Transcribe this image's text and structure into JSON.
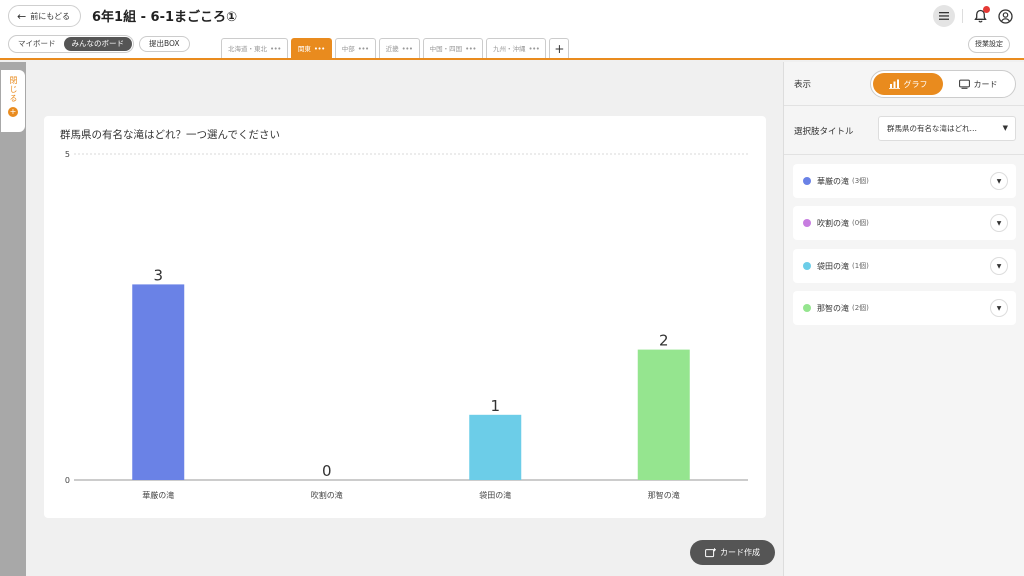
{
  "header": {
    "back_label": "前にもどる",
    "title": "6年1組 - 6-1まごころ①",
    "board_switch": [
      "マイボード",
      "みんなのボード"
    ],
    "submit_box": "提出BOX",
    "lesson_settings": "授業設定",
    "tabs": [
      {
        "label": "北海道・東北",
        "active": false
      },
      {
        "label": "関東",
        "active": true
      },
      {
        "label": "中部",
        "active": false
      },
      {
        "label": "近畿",
        "active": false
      },
      {
        "label": "中国・四国",
        "active": false
      },
      {
        "label": "九州・沖縄",
        "active": false
      }
    ],
    "tab_more": "•••",
    "add_tab": "+"
  },
  "side": {
    "close_label": "閉じる",
    "close_symbol": "+"
  },
  "chart_data": {
    "type": "bar",
    "title": "群馬県の有名な滝はどれ？一つ選んでください",
    "categories": [
      "華厳の滝",
      "吹割の滝",
      "袋田の滝",
      "那智の滝"
    ],
    "values": [
      3,
      0,
      1,
      2
    ],
    "value_labels": [
      "3",
      "0",
      "1",
      "2"
    ],
    "colors": [
      "#6a82e6",
      "#c77de0",
      "#6ccde8",
      "#95e58f"
    ],
    "ylim": [
      0,
      5
    ],
    "yticks": [
      "0",
      "5"
    ],
    "grid": "dashed-top",
    "legend": "none"
  },
  "create_card": "カード作成",
  "panel": {
    "display_label": "表示",
    "views": [
      "グラフ",
      "カード"
    ],
    "selection_title_label": "選択肢タイトル",
    "selection_title_value": "群馬県の有名な滝はどれ…",
    "choices": [
      {
        "name": "華厳の滝",
        "count": "(3個)",
        "color": "#6a82e6"
      },
      {
        "name": "吹割の滝",
        "count": "(0個)",
        "color": "#c77de0"
      },
      {
        "name": "袋田の滝",
        "count": "(1個)",
        "color": "#6ccde8"
      },
      {
        "name": "那智の滝",
        "count": "(2個)",
        "color": "#95e58f"
      }
    ]
  },
  "icons": {
    "back": "arrow-left-icon",
    "menu": "menu-icon",
    "bell": "bell-icon",
    "user": "user-circle-icon",
    "graph": "bar-chart-icon",
    "card": "card-icon",
    "dropdown": "caret-down-icon",
    "expand": "chevron-down-icon",
    "create": "add-card-icon"
  },
  "colors": {
    "accent": "#e98b1e",
    "notification": "#e53935"
  }
}
